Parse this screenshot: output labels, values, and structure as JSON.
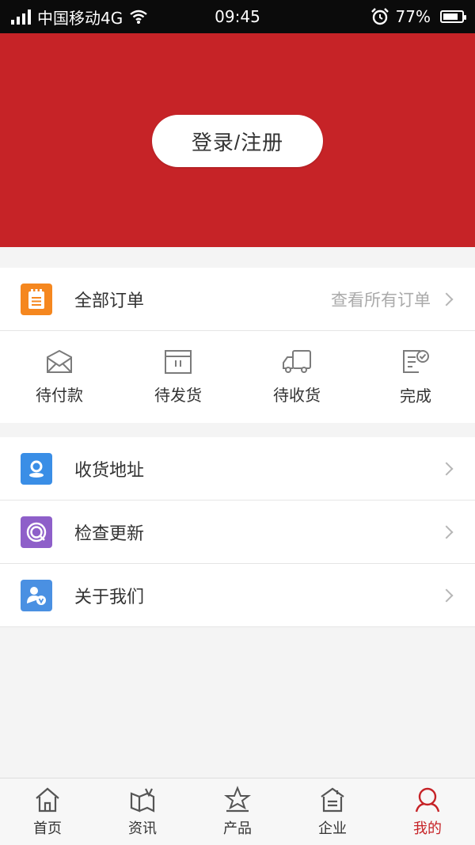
{
  "status_bar": {
    "carrier": "中国移动4G",
    "time": "09:45",
    "battery": "77%"
  },
  "header": {
    "login_label": "登录/注册"
  },
  "orders": {
    "title": "全部订单",
    "view_all": "查看所有订单",
    "statuses": [
      {
        "label": "待付款",
        "icon": "envelope-icon"
      },
      {
        "label": "待发货",
        "icon": "box-icon"
      },
      {
        "label": "待收货",
        "icon": "truck-icon"
      },
      {
        "label": "完成",
        "icon": "checked-doc-icon"
      }
    ]
  },
  "menu": {
    "items": [
      {
        "label": "收货地址",
        "icon": "location-icon",
        "color": "#3a8ee6"
      },
      {
        "label": "检查更新",
        "icon": "refresh-icon",
        "color": "#8e5fc9"
      },
      {
        "label": "关于我们",
        "icon": "user-icon",
        "color": "#4a90e2"
      }
    ]
  },
  "tabbar": {
    "items": [
      {
        "label": "首页",
        "icon": "home-icon"
      },
      {
        "label": "资讯",
        "icon": "news-icon"
      },
      {
        "label": "产品",
        "icon": "star-icon"
      },
      {
        "label": "企业",
        "icon": "building-icon"
      },
      {
        "label": "我的",
        "icon": "profile-icon",
        "active": true
      }
    ]
  },
  "colors": {
    "brand_red": "#c62327",
    "order_icon_orange": "#f5871f"
  }
}
